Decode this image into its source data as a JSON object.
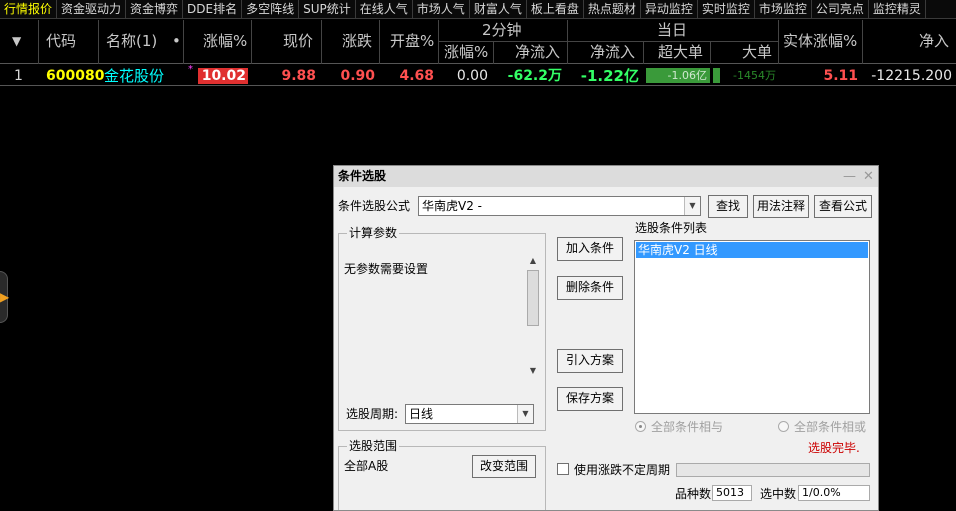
{
  "tabs": [
    "行情报价",
    "资金驱动力",
    "资金博弈",
    "DDE排名",
    "多空阵线",
    "SUP统计",
    "在线人气",
    "市场人气",
    "财富人气",
    "板上看盘",
    "热点题材",
    "异动监控",
    "实时监控",
    "市场监控",
    "公司亮点",
    "监控精灵"
  ],
  "table": {
    "headers": {
      "sort_arrow": "▼",
      "code": "代码",
      "name": "名称(1)",
      "dot": "•",
      "pct": "涨幅%",
      "price": "现价",
      "change": "涨跌",
      "open_pct": "开盘%",
      "group_2min": "2分钟",
      "pct_2min": "涨幅%",
      "netflow_2min": "净流入",
      "group_today": "当日",
      "netflow_today": "净流入",
      "super_large": "超大单",
      "large": "大单",
      "body_pct": "实体涨幅%",
      "net_in": "净入"
    },
    "rows": [
      {
        "index": "1",
        "code": "600080",
        "name": "金花股份",
        "marker": "*",
        "pct": "10.02",
        "price": "9.88",
        "change": "0.90",
        "open_pct": "4.68",
        "pct_2min": "0.00",
        "netflow_2min": "-62.2万",
        "netflow_today": "-1.22亿",
        "super_large": "-1.06亿",
        "large": "-1454万",
        "body_pct": "5.11",
        "net_in": "-12215.200"
      }
    ]
  },
  "dialog": {
    "title": "条件选股",
    "formula_label": "条件选股公式",
    "formula_value": "华南虎V2        -",
    "find_btn": "查找",
    "usage_btn": "用法注释",
    "view_formula_btn": "查看公式",
    "params_group": "计算参数",
    "params_text": "无参数需要设置",
    "period_label": "选股周期:",
    "period_value": "日线",
    "add_condition_btn": "加入条件",
    "delete_condition_btn": "删除条件",
    "import_plan_btn": "引入方案",
    "save_plan_btn": "保存方案",
    "condition_list_label": "选股条件列表",
    "condition_items": [
      "华南虎V2    日线"
    ],
    "radio_and": "全部条件相与",
    "radio_or": "全部条件相或",
    "status_text": "选股完毕.",
    "range_group": "选股范围",
    "range_value": "全部A股",
    "change_range_btn": "改变范围",
    "uncertain_period_label": "使用涨跌不定周期",
    "count_label": "品种数",
    "count_value": "5013",
    "selected_label": "选中数",
    "selected_value": "1/0.0%"
  },
  "colors": {
    "up": "#ff5050",
    "down": "#33ff66",
    "code": "#ffff00",
    "name": "#00ffff",
    "pct_bg": "#e03030",
    "super_bar": "#2f8f2f",
    "status": "#cc0000"
  }
}
